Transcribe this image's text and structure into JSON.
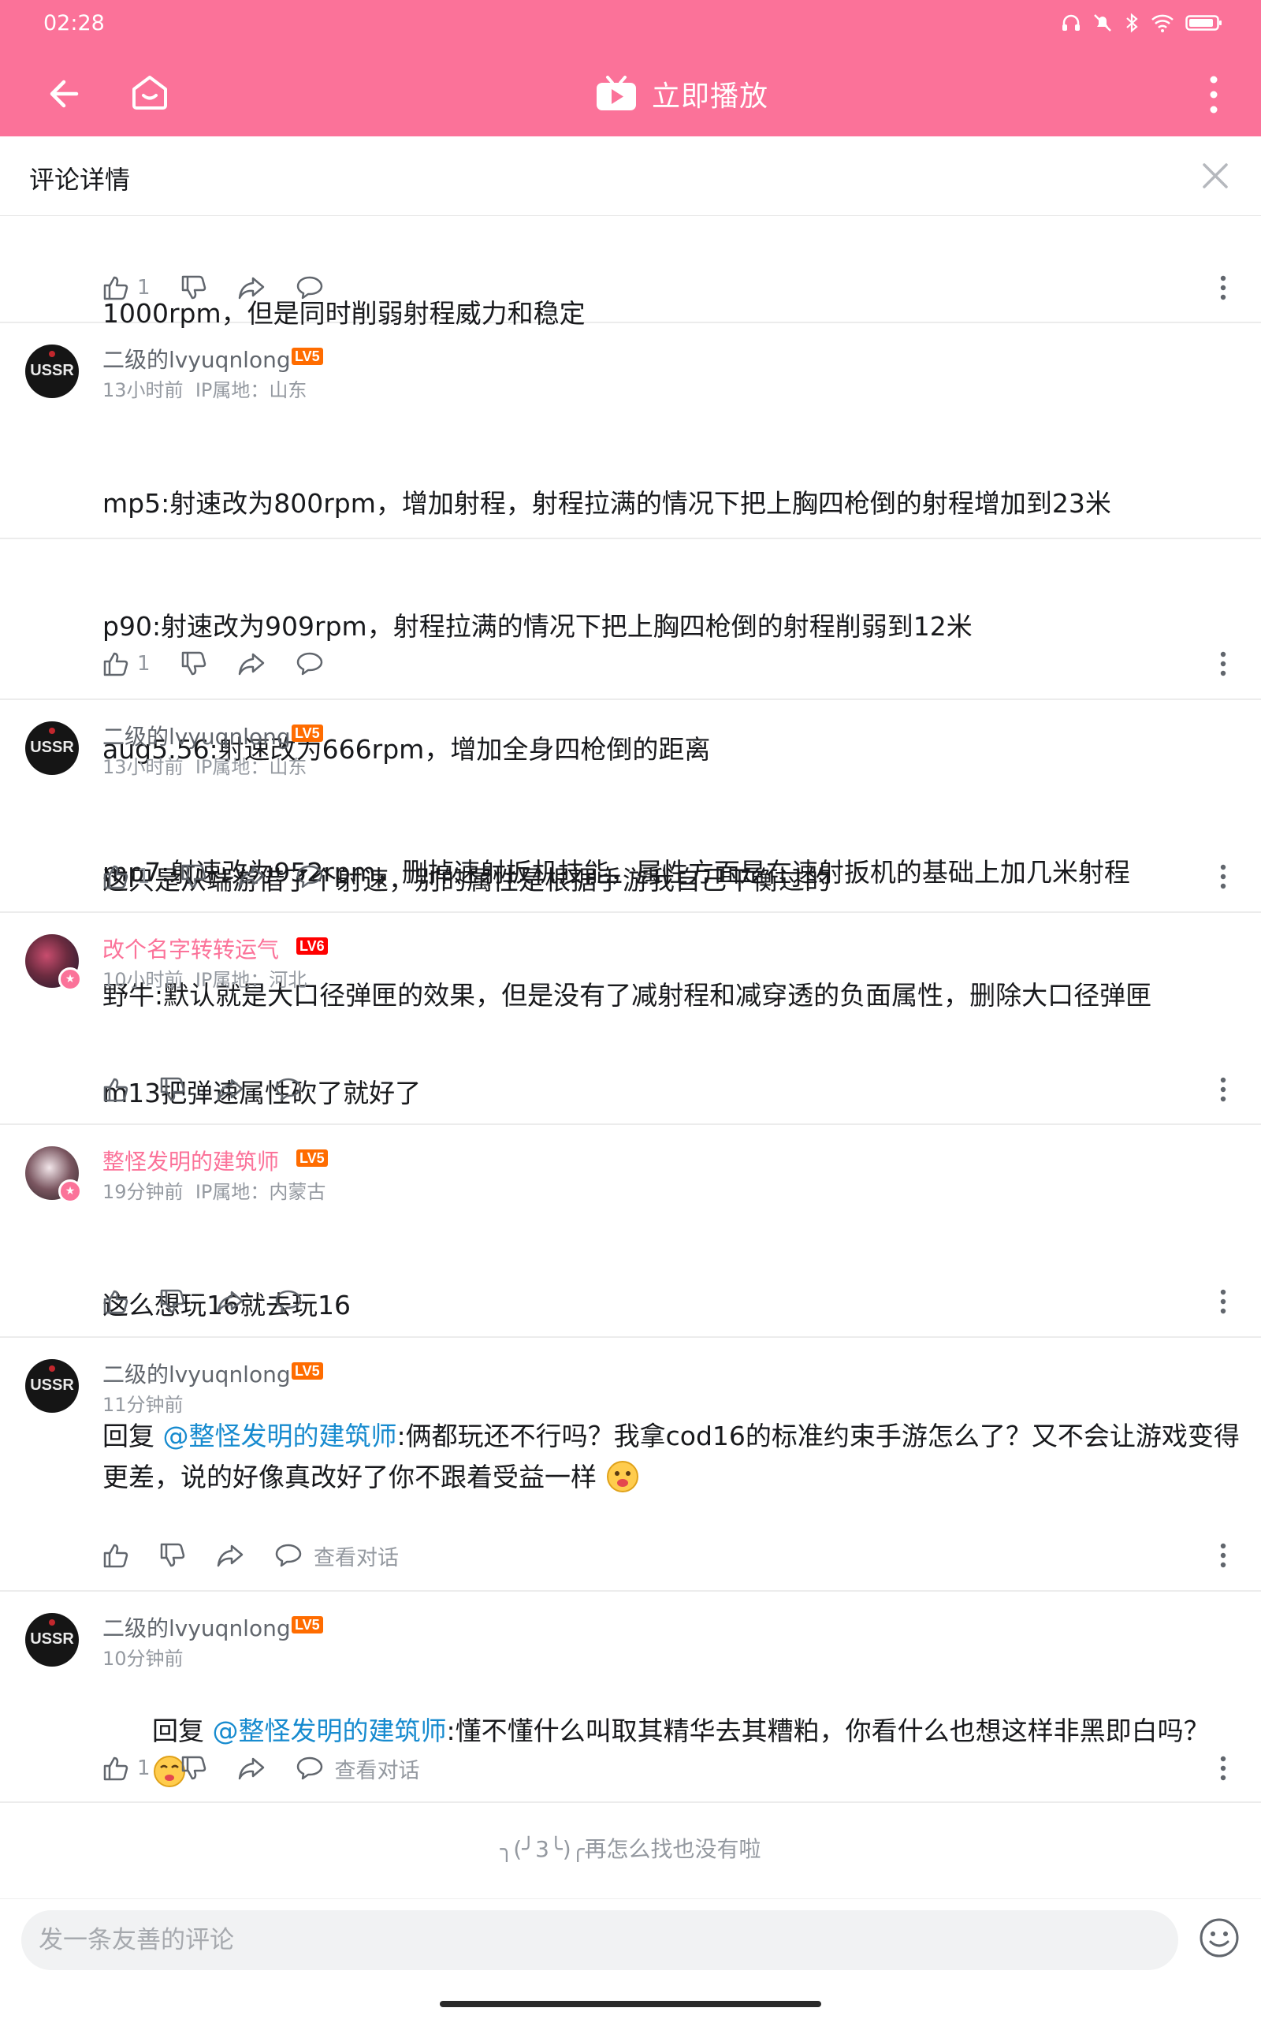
{
  "status_bar": {
    "time": "02:28"
  },
  "app_bar": {
    "play_now_label": "立即播放"
  },
  "detail": {
    "title": "评论详情"
  },
  "comments": [
    {
      "text_lines": [
        "1000rpm，但是同时削弱射程威力和稳定"
      ],
      "likes": "1"
    },
    {
      "username": "二级的lvyuqnlong",
      "level": "LV5",
      "time": "13小时前",
      "ip": "IP属地：山东",
      "text_lines": [
        "mp5:射速改为800rpm，增加射程，射程拉满的情况下把上胸四枪倒的射程增加到23米",
        "p90:射速改为909rpm，射程拉满的情况下把上胸四枪倒的射程削弱到12米",
        "aug5.56:射速改为666rpm，增加全身四枪倒的距离",
        "mp7:射速改为952rpm，删掉速射扳机技能，属性方面是在速射扳机的基础上加几米射程",
        "野牛:默认就是大口径弹匣的效果，但是没有了减射程和减穿透的负面属性，删除大口径弹匣"
      ],
      "likes": "1"
    },
    {
      "username": "二级的lvyuqnlong",
      "level": "LV5",
      "time": "13小时前",
      "ip": "IP属地：山东",
      "text_lines": [
        "这只是从端游借了个射速，别的属性是根据手游我自己平衡过的"
      ],
      "likes": "1"
    },
    {
      "username": "改个名字转转运气",
      "level": "LV6",
      "time": "10小时前",
      "ip": "IP属地：河北",
      "text_lines": [
        "m13把弹速属性砍了就好了"
      ],
      "likes": ""
    },
    {
      "username": "整怪发明的建筑师",
      "level": "LV5",
      "time": "19分钟前",
      "ip": "IP属地：内蒙古",
      "text_lines": [
        "这么想玩16就去玩16"
      ],
      "likes": ""
    },
    {
      "username": "二级的lvyuqnlong",
      "level": "LV5",
      "time": "11分钟前",
      "reply_prefix": "回复 ",
      "mention": "@整怪发明的建筑师",
      "text": ":俩都玩还不行吗？我拿cod16的标准约束手游怎么了？又不会让游戏变得更差，说的好像真改好了你不跟着受益一样",
      "likes": "",
      "view_dialog": "查看对话"
    },
    {
      "username": "二级的lvyuqnlong",
      "level": "LV5",
      "time": "10分钟前",
      "reply_prefix": "回复 ",
      "mention": "@整怪发明的建筑师",
      "text": ":懂不懂什么叫取其精华去其糟粕，你看什么也想这样非黑即白吗？",
      "likes": "1",
      "view_dialog": "查看对话"
    }
  ],
  "end_message": "╮(╯3╰)╭再怎么找也没有啦",
  "input": {
    "placeholder": "发一条友善的评论"
  },
  "avatars": {
    "ussr_text": "USSR"
  },
  "colors": {
    "brand_pink": "#fb7299",
    "link_blue": "#178bcf",
    "lv5": "#ff6c00",
    "lv6": "#ff0000"
  }
}
